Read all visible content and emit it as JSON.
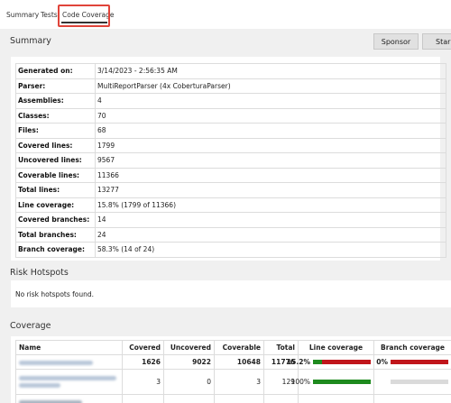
{
  "tabs": [
    {
      "label": "Summary"
    },
    {
      "label": "Tests"
    },
    {
      "label": "Code Coverage"
    }
  ],
  "summary": {
    "title": "Summary",
    "buttons": {
      "sponsor": "Sponsor",
      "star": "Star"
    },
    "rows": [
      {
        "key": "Generated on:",
        "value": "3/14/2023 - 2:56:35 AM"
      },
      {
        "key": "Parser:",
        "value": "MultiReportParser (4x CoberturaParser)"
      },
      {
        "key": "Assemblies:",
        "value": "4"
      },
      {
        "key": "Classes:",
        "value": "70"
      },
      {
        "key": "Files:",
        "value": "68"
      },
      {
        "key": "Covered lines:",
        "value": "1799"
      },
      {
        "key": "Uncovered lines:",
        "value": "9567"
      },
      {
        "key": "Coverable lines:",
        "value": "11366"
      },
      {
        "key": "Total lines:",
        "value": "13277"
      },
      {
        "key": "Line coverage:",
        "value": "15.8% (1799 of 11366)"
      },
      {
        "key": "Covered branches:",
        "value": "14"
      },
      {
        "key": "Total branches:",
        "value": "24"
      },
      {
        "key": "Branch coverage:",
        "value": "58.3% (14 of 24)"
      }
    ]
  },
  "hotspots": {
    "title": "Risk Hotspots",
    "empty_text": "No risk hotspots found."
  },
  "coverage": {
    "title": "Coverage",
    "headers": {
      "name": "Name",
      "covered": "Covered",
      "uncovered": "Uncovered",
      "coverable": "Coverable",
      "total": "Total",
      "line_coverage": "Line coverage",
      "branch_coverage": "Branch coverage"
    },
    "rows": [
      {
        "covered": "1626",
        "uncovered": "9022",
        "coverable": "10648",
        "total": "11776",
        "line_pct": "15.2%",
        "line_fraction": 0.152,
        "branch_pct": "0%",
        "branch_fraction": 0.0
      },
      {
        "covered": "3",
        "uncovered": "0",
        "coverable": "3",
        "total": "129",
        "line_pct": "100%",
        "line_fraction": 1.0,
        "branch_pct": "",
        "branch_fraction": null
      }
    ],
    "colors": {
      "covered": "#1e8a1e",
      "uncovered": "#c0151b",
      "na": "#dadada"
    }
  },
  "colors": {
    "highlight": "#e0443a",
    "section_bg": "#f0f0f0"
  }
}
